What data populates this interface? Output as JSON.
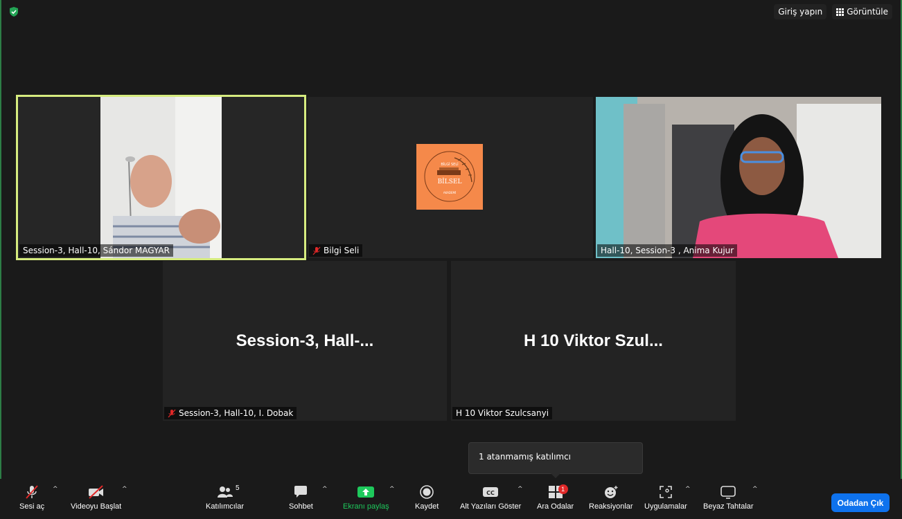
{
  "topbar": {
    "signin_label": "Giriş yapın",
    "view_label": "Görüntüle"
  },
  "tiles": [
    {
      "name": "Session-3, Hall-10, Sándor MAGYAR",
      "muted": false,
      "active": true
    },
    {
      "name": "Bilgi Seli",
      "muted": true
    },
    {
      "name": "Hall-10, Session-3 , Anima Kujur",
      "muted": false
    },
    {
      "name": "Session-3, Hall-10, I. Dobak",
      "muted": true,
      "display": "Session-3,  Hall-..."
    },
    {
      "name": "H 10 Viktor Szulcsanyi",
      "muted": false,
      "display": "H 10 Viktor Szul..."
    }
  ],
  "logo": {
    "top_text": "BİLGİ SELİ",
    "main_text": "BİLSEL",
    "bottom_text": "AKADEMİ",
    "bg_color": "#f5894a"
  },
  "tooltip": {
    "text": "1 atanmamış katılımcı"
  },
  "toolbar": {
    "audio": "Sesi aç",
    "video": "Videoyu Başlat",
    "participants": "Katılımcılar",
    "participants_count": "5",
    "chat": "Sohbet",
    "share": "Ekranı paylaş",
    "record": "Kaydet",
    "captions": "Alt Yazıları Göster",
    "captions_icon": "CC",
    "breakout": "Ara Odalar",
    "breakout_badge": "1",
    "reactions": "Reaksiyonlar",
    "apps": "Uygulamalar",
    "whiteboard": "Beyaz Tahtalar",
    "leave": "Odadan Çık"
  },
  "colors": {
    "accent": "#0e72ed",
    "share_green": "#1ec95c",
    "active_border": "#d6ec7f",
    "muted_red": "#e02828"
  }
}
